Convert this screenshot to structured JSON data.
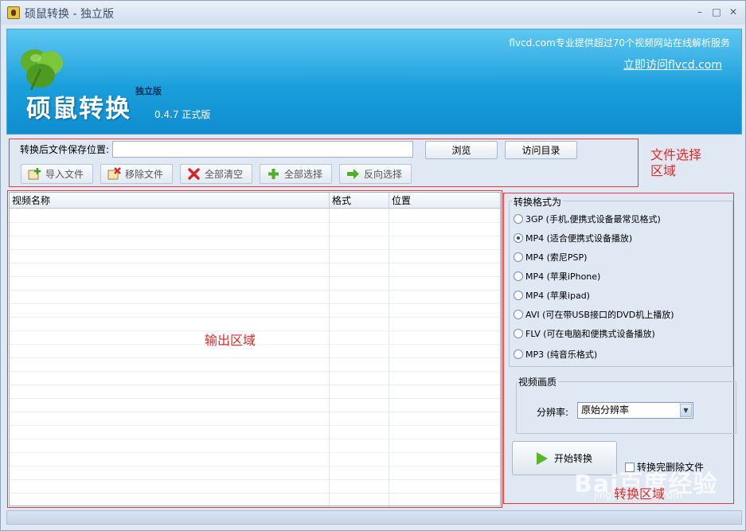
{
  "window": {
    "title": "硕鼠转换 - 独立版"
  },
  "banner": {
    "brand": "硕鼠转换",
    "edition": "独立版",
    "version": "0.4.7 正式版",
    "tagline": "flvcd.com专业提供超过70个视频网站在线解析服务",
    "link": "立即访问flvcd.com"
  },
  "file_section": {
    "save_label": "转换后文件保存位置:",
    "save_value": "",
    "browse": "浏览",
    "visit_dir": "访问目录",
    "import": "导入文件",
    "remove": "移除文件",
    "clear_all": "全部清空",
    "select_all": "全部选择",
    "invert": "反向选择",
    "annotation_line1": "文件选择",
    "annotation_line2": "区域"
  },
  "list": {
    "columns": [
      "视频名称",
      "格式",
      "位置"
    ],
    "rows": [],
    "annotation": "输出区域"
  },
  "convert": {
    "format_group": "转换格式为",
    "formats": [
      {
        "label": "3GP (手机,便携式设备最常见格式)",
        "selected": false
      },
      {
        "label": "MP4 (适合便携式设备播放)",
        "selected": true
      },
      {
        "label": "MP4 (索尼PSP)",
        "selected": false
      },
      {
        "label": "MP4 (苹果iPhone)",
        "selected": false
      },
      {
        "label": "MP4 (苹果ipad)",
        "selected": false
      },
      {
        "label": "AVI (可在带USB接口的DVD机上播放)",
        "selected": false
      },
      {
        "label": "FLV (可在电脑和便携式设备播放)",
        "selected": false
      },
      {
        "label": "MP3 (纯音乐格式)",
        "selected": false
      }
    ],
    "quality_group": "视频画质",
    "resolution_label": "分辨率:",
    "resolution_value": "原始分辨率",
    "start": "开始转换",
    "delete_after": "转换完删除文件",
    "annotation": "转换区域"
  },
  "watermark": {
    "main": "Bai百度经验",
    "sub": "jingyan.baidu.com"
  }
}
